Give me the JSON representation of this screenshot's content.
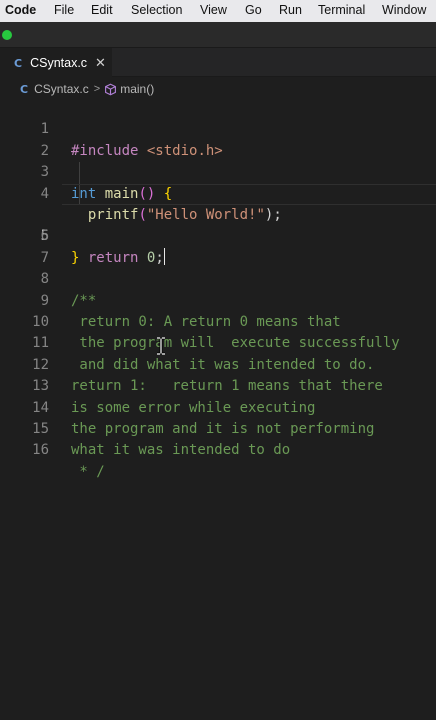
{
  "menubar": {
    "items": [
      "Code",
      "File",
      "Edit",
      "Selection",
      "View",
      "Go",
      "Run",
      "Terminal",
      "Window"
    ]
  },
  "tabs": [
    {
      "icon": "C",
      "label": "CSyntax.c",
      "close": "✕"
    }
  ],
  "breadcrumb": {
    "file_icon": "C",
    "file": "CSyntax.c",
    "separator": ">",
    "symbol": "main()"
  },
  "editor": {
    "active_line": 5,
    "lines": [
      {
        "n": "1",
        "text": "#include <stdio.h>"
      },
      {
        "n": "2",
        "text": ""
      },
      {
        "n": "3",
        "text": "int main() {"
      },
      {
        "n": "4",
        "text": "  printf(\"Hello World!\");"
      },
      {
        "n": "5",
        "text": "  return 0;"
      },
      {
        "n": "6",
        "text": "}"
      },
      {
        "n": "7",
        "text": ""
      },
      {
        "n": "8",
        "text": "/**"
      },
      {
        "n": "9",
        "text": " return 0: A return 0 means that"
      },
      {
        "n": "10",
        "text": " the program will  execute successfully"
      },
      {
        "n": "11",
        "text": " and did what it was intended to do."
      },
      {
        "n": "12",
        "text": "return 1: I return 1 means that there"
      },
      {
        "n": "13",
        "text": "is some error while executing"
      },
      {
        "n": "14",
        "text": "the program and it is not performing"
      },
      {
        "n": "15",
        "text": "what it was intended to do"
      },
      {
        "n": "16",
        "text": " * /"
      }
    ],
    "tokens": {
      "l1": [
        "#include",
        " <stdio.h>"
      ],
      "l3": [
        "int",
        " ",
        "main",
        "()",
        " ",
        "{"
      ],
      "l4": [
        "  ",
        "printf",
        "(",
        "\"Hello World!\"",
        ");"
      ],
      "l5": [
        "  ",
        "return",
        " ",
        "0",
        ";"
      ],
      "l6": [
        "}"
      ],
      "l8": [
        "/**"
      ],
      "l9": [
        " return 0: A return 0 means that"
      ],
      "l10": [
        " the program will  execute successfully"
      ],
      "l11": [
        " and did what it was intended to do."
      ],
      "l12": [
        "return 1: ",
        " return 1 means that there"
      ],
      "l13": [
        "is some error while executing"
      ],
      "l14": [
        "the program and it is not performing"
      ],
      "l15": [
        "what it was intended to do"
      ],
      "l16": [
        " * /"
      ]
    }
  },
  "colors": {
    "keyword": "#569cd6",
    "function": "#dcdcaa",
    "string": "#ce9178",
    "comment": "#6a9955",
    "control": "#c586c0",
    "bracket": "#ffd700",
    "number": "#b5cea8",
    "background": "#1e1e1e"
  }
}
